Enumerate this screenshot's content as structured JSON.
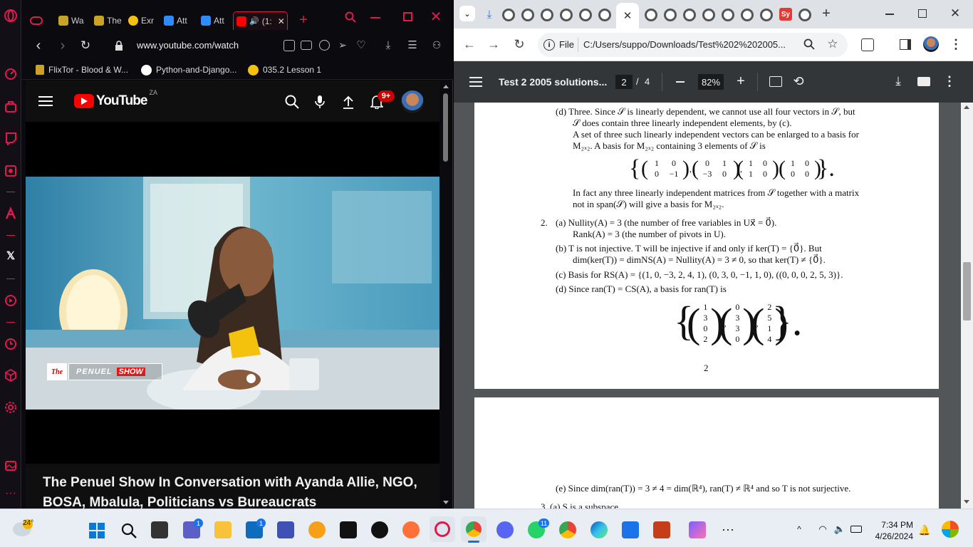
{
  "opera": {
    "tabs": [
      {
        "label": "Wa"
      },
      {
        "label": "The"
      },
      {
        "label": "Exr"
      },
      {
        "label": "Att"
      },
      {
        "label": "Att"
      },
      {
        "label": "(1:"
      }
    ],
    "url": "www.youtube.com/watch",
    "bookmarks": [
      {
        "label": "FlixTor - Blood & W..."
      },
      {
        "label": "Python-and-Django..."
      },
      {
        "label": "035.2 Lesson 1"
      }
    ],
    "accent": "#e01a4f"
  },
  "youtube": {
    "logo_text": "YouTube",
    "country": "ZA",
    "notifications": "9+",
    "video_title": "The Penuel Show In Conversation with Ayanda Allie, NGO, BOSA, Mbalula, Politicians vs Bureaucrats",
    "overlay": {
      "the": "The",
      "show_name": "PENUEL",
      "show_word": "SHOW"
    }
  },
  "chrome": {
    "url_scheme": "File",
    "url": "C:/Users/suppo/Downloads/Test%202%202005...",
    "profile_letters": "Sy"
  },
  "pdf": {
    "title": "Test 2 2005 solutions...",
    "page_current": "2",
    "page_sep": "/",
    "page_total": "4",
    "zoom": "82%",
    "page_number": "2",
    "p_d1": "(d)  Three.  Since 𝒮 is linearly dependent, we cannot use all four vectors in 𝒮, but",
    "p_d2": "𝒮 does contain three linearly independent elements, by (c).",
    "p_d3": "A set of three such linearly independent vectors can be enlarged to a basis for",
    "p_d4": "M₂ₓ₂.  A basis for M₂ₓ₂ containing 3 elements of 𝒮 is",
    "p_d5": "In fact any three linearly independent matrices from 𝒮 together with a matrix",
    "p_d6": "not in span(𝒮) will give a basis for M₂ₓ₂.",
    "q2_num": "2.",
    "q2a1": "(a)  Nullity(A) = 3 (the number of free variables in Ux⃗ = 0⃗).",
    "q2a2": "Rank(A) = 3 (the number of pivots in U).",
    "q2b1": "(b)  T is not injective.  T will be injective if and only if ker(T) = {0⃗}.  But",
    "q2b2": "dim(ker(T)) = dimNS(A) = Nullity(A) = 3 ≠ 0, so that ker(T) ≠ {0⃗}.",
    "q2c": "(c)  Basis for RS(A) = {(1, 0, −3, 2, 4, 1), (0, 3, 0, −1, 1, 0), ((0, 0, 0, 2, 5, 3)}.",
    "q2d": "(d)  Since ran(T) = CS(A), a basis for ran(T) is",
    "q2e": "(e)  Since dim(ran(T)) = 3 ≠ 4 = dim(ℝ⁴), ran(T) ≠ ℝ⁴ and so T is not surjective.",
    "q3_partial": "3.    (a)  S is a subspace",
    "matrices_2x2": [
      [
        "1",
        "0",
        "0",
        "−1"
      ],
      [
        "0",
        "1",
        "−3",
        "0"
      ],
      [
        "1",
        "0",
        "1",
        "0"
      ],
      [
        "1",
        "0",
        "0",
        "0"
      ]
    ],
    "vectors_4": [
      [
        "1",
        "3",
        "0",
        "2"
      ],
      [
        "0",
        "3",
        "3",
        "0"
      ],
      [
        "2",
        "5",
        "1",
        "4"
      ]
    ]
  },
  "taskbar": {
    "weather": "24°",
    "time": "7:34 PM",
    "date": "4/26/2024",
    "teams_badge": "1",
    "store_badge": "1",
    "whatsapp_badge": "11"
  }
}
